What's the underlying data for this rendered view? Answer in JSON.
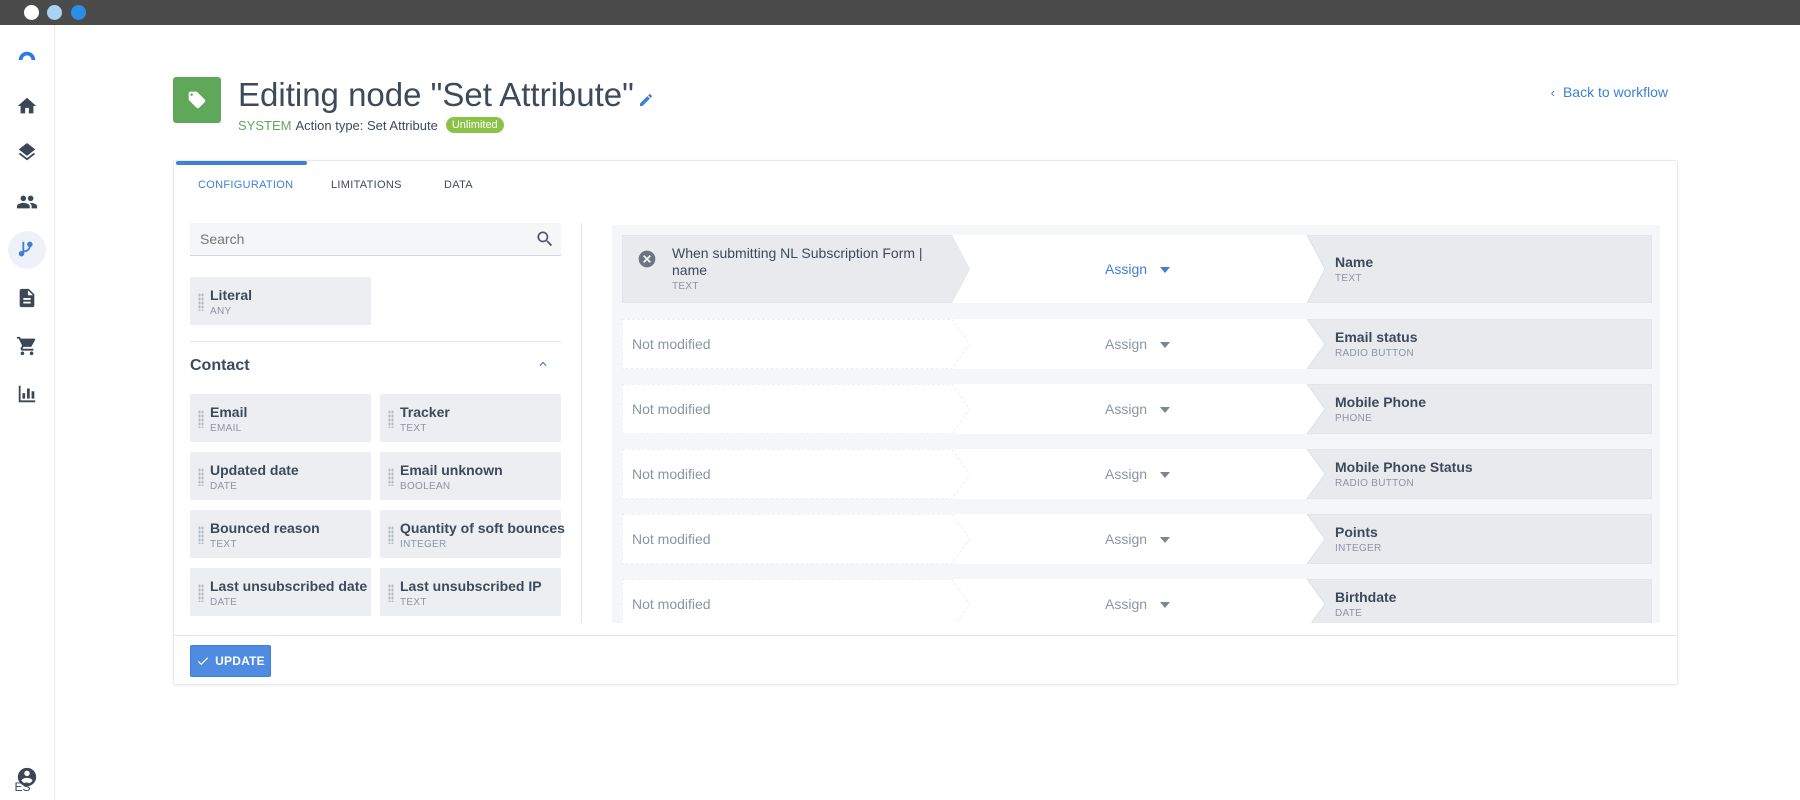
{
  "window": {
    "controls": [
      "close",
      "minimize",
      "maximize"
    ],
    "control_colors": [
      "#ffffff",
      "#a9d3f0",
      "#2a8de6"
    ]
  },
  "sidebar": {
    "items": [
      {
        "icon": "logo-icon"
      },
      {
        "icon": "home-icon"
      },
      {
        "icon": "layers-icon"
      },
      {
        "icon": "people-icon"
      },
      {
        "icon": "workflow-icon",
        "active": true
      },
      {
        "icon": "document-icon"
      },
      {
        "icon": "cart-icon"
      },
      {
        "icon": "bar-chart-icon"
      }
    ],
    "account_icon": "account-icon",
    "language": "ES"
  },
  "header": {
    "title": "Editing node \"Set Attribute\"",
    "system_label": "SYSTEM",
    "action_type": "Action type: Set Attribute",
    "badge": "Unlimited",
    "back_link": "Back to workflow"
  },
  "tabs": [
    {
      "label": "CONFIGURATION",
      "active": true
    },
    {
      "label": "LIMITATIONS"
    },
    {
      "label": "DATA"
    }
  ],
  "left_panel": {
    "search_placeholder": "Search",
    "literal": {
      "name": "Literal",
      "type": "ANY"
    },
    "group_title": "Contact",
    "attributes": [
      {
        "name": "Email",
        "type": "EMAIL"
      },
      {
        "name": "Tracker",
        "type": "TEXT"
      },
      {
        "name": "Updated date",
        "type": "DATE"
      },
      {
        "name": "Email unknown",
        "type": "BOOLEAN"
      },
      {
        "name": "Bounced reason",
        "type": "TEXT"
      },
      {
        "name": "Quantity of soft bounces",
        "type": "INTEGER"
      },
      {
        "name": "Last unsubscribed date",
        "type": "DATE"
      },
      {
        "name": "Last unsubscribed IP",
        "type": "TEXT"
      }
    ]
  },
  "mappings": [
    {
      "source": "When submitting NL Subscription Form | name",
      "source_type": "TEXT",
      "operation": "Assign",
      "target": "Name",
      "target_type": "TEXT",
      "set": true
    },
    {
      "source": "Not modified",
      "operation": "Assign",
      "target": "Email status",
      "target_type": "RADIO BUTTON"
    },
    {
      "source": "Not modified",
      "operation": "Assign",
      "target": "Mobile Phone",
      "target_type": "PHONE"
    },
    {
      "source": "Not modified",
      "operation": "Assign",
      "target": "Mobile Phone Status",
      "target_type": "RADIO BUTTON"
    },
    {
      "source": "Not modified",
      "operation": "Assign",
      "target": "Points",
      "target_type": "INTEGER"
    },
    {
      "source": "Not modified",
      "operation": "Assign",
      "target": "Birthdate",
      "target_type": "DATE"
    }
  ],
  "footer": {
    "update_label": "UPDATE"
  },
  "colors": {
    "accent": "#3f7fd6",
    "node_green": "#5fa85a",
    "badge_green": "#8bc34a"
  }
}
